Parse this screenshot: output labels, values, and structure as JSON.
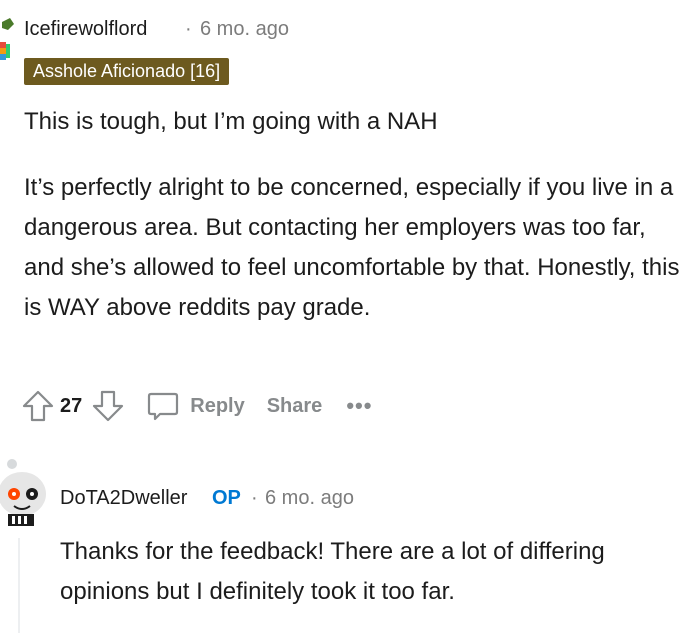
{
  "comment": {
    "username": "Icefirewolflord",
    "separator": "·",
    "time": "6 mo. ago",
    "flair": "Asshole Aficionado [16]",
    "paragraphs": [
      "This is tough, but I’m going with a NAH",
      "It’s perfectly alright to be concerned, especially if you live in a dangerous area. But contacting her employers was too far, and she’s allowed to feel uncomfortable by that. Honestly, this is WAY above reddits pay grade."
    ],
    "votes": "27",
    "reply_label": "Reply",
    "share_label": "Share",
    "more_label": "•••",
    "flair_color": "#6d5a1f"
  },
  "reply": {
    "username": "DoTA2Dweller",
    "op_badge": "OP",
    "separator": "·",
    "time": "6 mo. ago",
    "text": "Thanks for the feedback! There are a lot of differing opinions but I definitely took it too far.",
    "op_color": "#0079d3"
  },
  "icons": {
    "upvote": "upvote-arrow-icon",
    "downvote": "downvote-arrow-icon",
    "reply": "chat-bubble-icon",
    "more": "more-dots-icon"
  }
}
